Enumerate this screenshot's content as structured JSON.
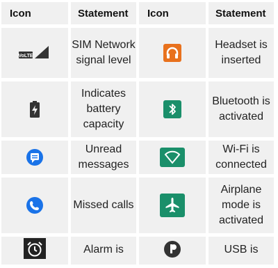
{
  "header": {
    "col1": "Icon",
    "col2": "Statement",
    "col3": "Icon",
    "col4": "Statement"
  },
  "rows": [
    {
      "left_icon": "volte-signal-icon",
      "left_icon_text": "VoLTE",
      "left_statement": "SIM Network signal level",
      "right_icon": "headset-icon",
      "right_statement": "Headset is inserted"
    },
    {
      "left_icon": "battery-charging-icon",
      "left_statement": "Indicates battery capacity",
      "right_icon": "bluetooth-icon",
      "right_statement": "Bluetooth is activated"
    },
    {
      "left_icon": "message-icon",
      "left_statement": "Unread messages",
      "right_icon": "wifi-icon",
      "right_statement": "Wi-Fi is connected"
    },
    {
      "left_icon": "phone-icon",
      "left_statement": "Missed calls",
      "right_icon": "airplane-icon",
      "right_statement": "Airplane mode is activated"
    },
    {
      "left_icon": "alarm-icon",
      "left_statement": "Alarm is",
      "right_icon": "usb-icon",
      "right_statement": "USB is"
    }
  ],
  "colors": {
    "cell_bg": "#f0f0f0",
    "headset_orange": "#e8711d",
    "green": "#1a8f6a",
    "blue": "#1a73e8"
  }
}
